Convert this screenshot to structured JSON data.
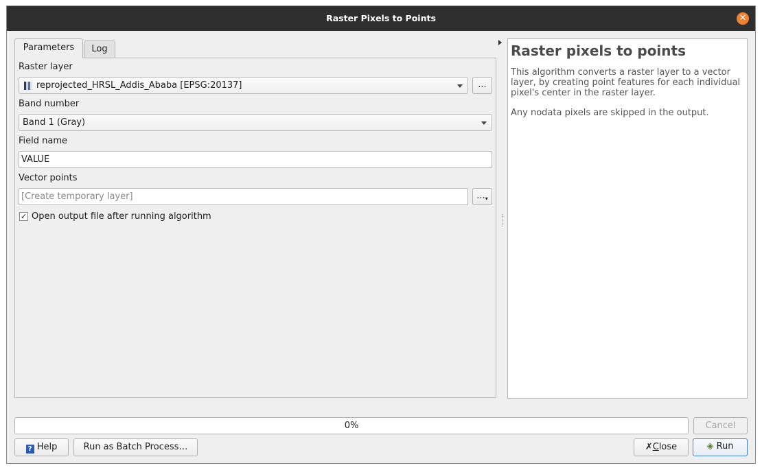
{
  "window": {
    "title": "Raster Pixels to Points"
  },
  "tabs": [
    {
      "label": "Parameters",
      "active": true
    },
    {
      "label": "Log",
      "active": false
    }
  ],
  "params": {
    "raster_layer": {
      "label": "Raster layer",
      "value": "reprojected_HRSL_Addis_Ababa [EPSG:20137]",
      "browse": "..."
    },
    "band": {
      "label": "Band number",
      "value": "Band 1 (Gray)"
    },
    "field_name": {
      "label": "Field name",
      "value": "VALUE"
    },
    "vector_points": {
      "label": "Vector points",
      "placeholder": "[Create temporary layer]",
      "browse": "..."
    },
    "open_output": {
      "label": "Open output file after running algorithm",
      "checked": true,
      "mark": "✓"
    }
  },
  "help": {
    "title": "Raster pixels to points",
    "paragraph1": "This algorithm converts a raster layer to a vector layer, by creating point features for each individual pixel's center in the raster layer.",
    "paragraph2": "Any nodata pixels are skipped in the output."
  },
  "progress": {
    "percent": 0,
    "label": "0%"
  },
  "buttons": {
    "cancel": "Cancel",
    "help": "Help",
    "batch": "Run as Batch Process…",
    "close_rest": "lose",
    "close_mnemonic": "C",
    "run": "Run"
  },
  "colors": {
    "titlebar": "#2f2f2f",
    "close_icon": "#f0812d",
    "background": "#efefef"
  }
}
